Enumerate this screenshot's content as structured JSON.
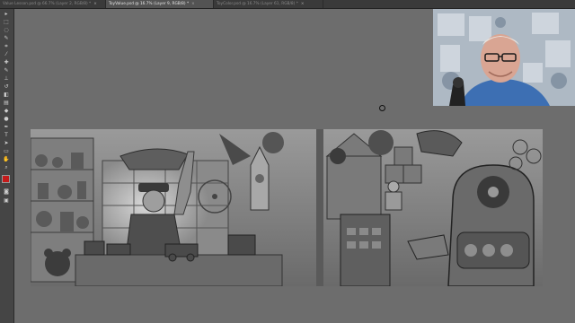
{
  "tabs": [
    {
      "label": "Value Lesson.psd @ 66.7% (Layer 2, RGB/8) *",
      "close": "×",
      "active": false
    },
    {
      "label": "ToyValue.psd @ 16.7% (Layer 9, RGB/8) *",
      "close": "×",
      "active": true
    },
    {
      "label": "ToyColor.psd @ 16.7% (Layer 61, RGB/8) *",
      "close": "×",
      "active": false
    }
  ],
  "tools": [
    {
      "name": "move-tool-icon",
      "glyph": "▸"
    },
    {
      "name": "marquee-tool-icon",
      "glyph": "⬚"
    },
    {
      "name": "lasso-tool-icon",
      "glyph": "◌"
    },
    {
      "name": "quick-select-tool-icon",
      "glyph": "✎"
    },
    {
      "name": "crop-tool-icon",
      "glyph": "⌗"
    },
    {
      "name": "eyedropper-tool-icon",
      "glyph": "⁄"
    },
    {
      "name": "healing-brush-tool-icon",
      "glyph": "✚"
    },
    {
      "name": "brush-tool-icon",
      "glyph": "✎"
    },
    {
      "name": "clone-stamp-tool-icon",
      "glyph": "⊥"
    },
    {
      "name": "history-brush-tool-icon",
      "glyph": "↺"
    },
    {
      "name": "eraser-tool-icon",
      "glyph": "◧"
    },
    {
      "name": "gradient-tool-icon",
      "glyph": "▤"
    },
    {
      "name": "blur-tool-icon",
      "glyph": "◆"
    },
    {
      "name": "dodge-tool-icon",
      "glyph": "●"
    },
    {
      "name": "pen-tool-icon",
      "glyph": "✒"
    },
    {
      "name": "type-tool-icon",
      "glyph": "T"
    },
    {
      "name": "path-select-tool-icon",
      "glyph": "➤"
    },
    {
      "name": "shape-tool-icon",
      "glyph": "▭"
    },
    {
      "name": "hand-tool-icon",
      "glyph": "✋"
    },
    {
      "name": "zoom-tool-icon",
      "glyph": "⌕"
    }
  ],
  "colors": {
    "foreground": "#c41a1a",
    "background": "#ffffff",
    "workspace": "#6d6d6d",
    "tabbar": "#3a3a3a"
  }
}
